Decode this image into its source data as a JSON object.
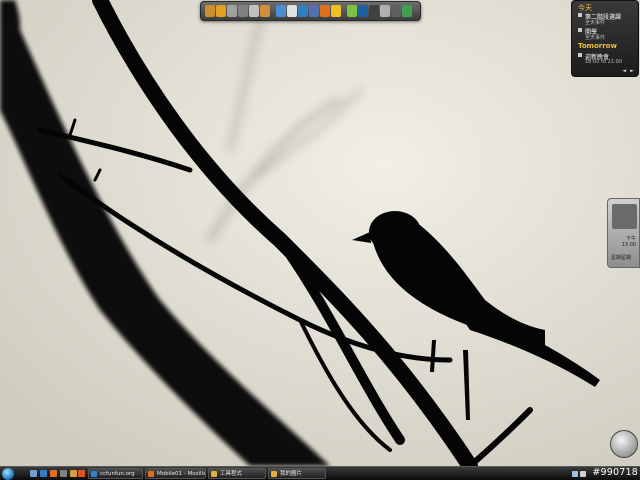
{
  "dock": {
    "icons": [
      {
        "name": "book-icon",
        "color": "#c89030"
      },
      {
        "name": "pen-icon",
        "color": "#e0a020"
      },
      {
        "name": "tools-icon",
        "color": "#a0a0a0"
      },
      {
        "name": "gear-icon",
        "color": "#808080"
      },
      {
        "name": "clock-icon",
        "color": "#c0c0c0"
      },
      {
        "name": "folder-icon",
        "color": "#d09040"
      },
      {
        "name": "image-icon",
        "color": "#4a90d0"
      },
      {
        "name": "mail-icon",
        "color": "#e0e0e0"
      },
      {
        "name": "globe-icon",
        "color": "#3080c0"
      },
      {
        "name": "user-icon",
        "color": "#5070b0"
      },
      {
        "name": "firefox-icon",
        "color": "#e07020"
      },
      {
        "name": "star-icon",
        "color": "#f0c020"
      },
      {
        "name": "android-icon",
        "color": "#80c040"
      },
      {
        "name": "chart-icon",
        "color": "#2060a0"
      },
      {
        "name": "film-icon",
        "color": "#404040"
      },
      {
        "name": "disc-icon",
        "color": "#b0b0b0"
      },
      {
        "name": "gamepad-icon",
        "color": "#606060"
      },
      {
        "name": "recycle-icon",
        "color": "#40a050"
      }
    ]
  },
  "calendar": {
    "day_heading": "今天",
    "events": [
      {
        "title": "第二階段選課",
        "sub": "全天事件"
      },
      {
        "title": "開學",
        "sub": "全天事件"
      }
    ],
    "tomorrow_heading": "Tomorrow",
    "tomorrow_events": [
      {
        "title": "迎新晚會",
        "sub": "18:00 to 21:00"
      }
    ],
    "nav_prev": "◄",
    "nav_next": "►"
  },
  "clock": {
    "line1": "下午",
    "line2": "13:00",
    "line3": "星期星期"
  },
  "taskbar": {
    "quicklaunch": [
      {
        "name": "show-desktop-icon",
        "color": "#6fa0d0"
      },
      {
        "name": "ie-icon",
        "color": "#3080d0"
      },
      {
        "name": "firefox-icon",
        "color": "#e07020"
      },
      {
        "name": "media-icon",
        "color": "#808080"
      },
      {
        "name": "window-switch-icon",
        "color": "#d0a040"
      },
      {
        "name": "office-icon",
        "color": "#e05020"
      }
    ],
    "tasks": [
      {
        "label": "ccfunfun.org",
        "icon": "#3080d0"
      },
      {
        "label": "Mobile01 - Mozilla Fi...",
        "icon": "#e07020"
      },
      {
        "label": "工具程式",
        "icon": "#e0b040"
      },
      {
        "label": "我的圖片",
        "icon": "#e0b040"
      }
    ],
    "tray_icons": [
      {
        "name": "network-icon",
        "color": "#a0c0e0"
      },
      {
        "name": "volume-icon",
        "color": "#d0d0d0"
      }
    ],
    "watermark": "#990718"
  }
}
